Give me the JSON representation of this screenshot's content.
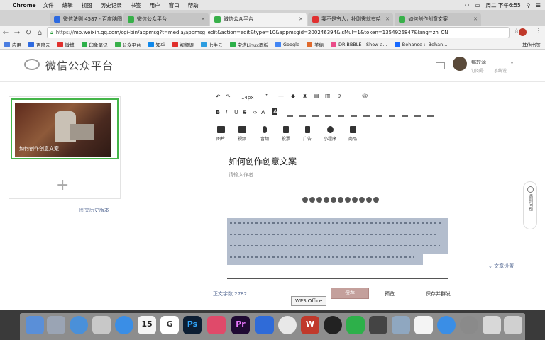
{
  "menubar": {
    "app_name": "Chrome",
    "items": [
      "文件",
      "编辑",
      "视图",
      "历史记录",
      "书签",
      "用户",
      "窗口",
      "帮助"
    ],
    "clock": "周二 下午6:55"
  },
  "tabs": [
    {
      "title": "微信法则 4587 - 百度脑图",
      "active": false
    },
    {
      "title": "微信公众平台",
      "active": false
    },
    {
      "title": "微信公众平台",
      "active": true
    },
    {
      "title": "我不是穷人，补刚需就有哈",
      "active": false
    },
    {
      "title": "如何创作创意文案",
      "active": false
    }
  ],
  "address_bar": {
    "secure_label": "https://",
    "url": "mp.weixin.qq.com/cgi-bin/appmsg?t=media/appmsg_edit&action=edit&type=10&appmsgid=200246394&isMul=1&token=1354926847&lang=zh_CN"
  },
  "bookmarks": {
    "items": [
      "应用",
      "百度云",
      "微博",
      "印象笔记",
      "公众平台",
      "知乎",
      "视频课",
      "七牛云",
      "宝塔Linux面板",
      "Google",
      "美俪",
      "DRIBBBLE - Show a...",
      "Behance :: Behan..."
    ],
    "other": "其他书签"
  },
  "header": {
    "title": "微信公众平台",
    "account_name": "都较源",
    "account_type": "订阅号",
    "account_sys": "系统说"
  },
  "article_list": {
    "thumb_title": "如何创作创意文案",
    "add_symbol": "+",
    "history_link": "图文历史版本"
  },
  "editor": {
    "font_size": "14px",
    "insert_tools": [
      {
        "label": "图片",
        "icon": "image-icon"
      },
      {
        "label": "视频",
        "icon": "video-icon"
      },
      {
        "label": "音频",
        "icon": "audio-icon"
      },
      {
        "label": "投票",
        "icon": "vote-icon"
      },
      {
        "label": "广告",
        "icon": "ad-icon"
      },
      {
        "label": "小程序",
        "icon": "miniprogram-icon"
      },
      {
        "label": "商品",
        "icon": "product-icon"
      }
    ],
    "doc_title": "如何创作创意文案",
    "author_placeholder": "请输入作者",
    "article_settings": "文章设置",
    "help_label": "遇到问题"
  },
  "footer": {
    "word_count_label": "正文字数",
    "word_count": "2782",
    "save_label": "保存",
    "preview_label": "预览",
    "publish_label": "保存并群发",
    "tooltip": "WPS Office"
  },
  "dock": {
    "apps": [
      "Finder",
      "Launchpad",
      "Safari",
      "Preview",
      "App Store",
      "Calendar",
      "Sketch",
      "Photoshop",
      "Music",
      "Premiere",
      "Keynote",
      "Chrome",
      "Google Earth",
      "WPS",
      "QQ",
      "WeChat",
      "Sublime",
      "Fonts",
      "Notes",
      "Baidu Netdisk",
      "System Preferences",
      "Disk",
      "Trash"
    ],
    "calendar_day": "15"
  }
}
